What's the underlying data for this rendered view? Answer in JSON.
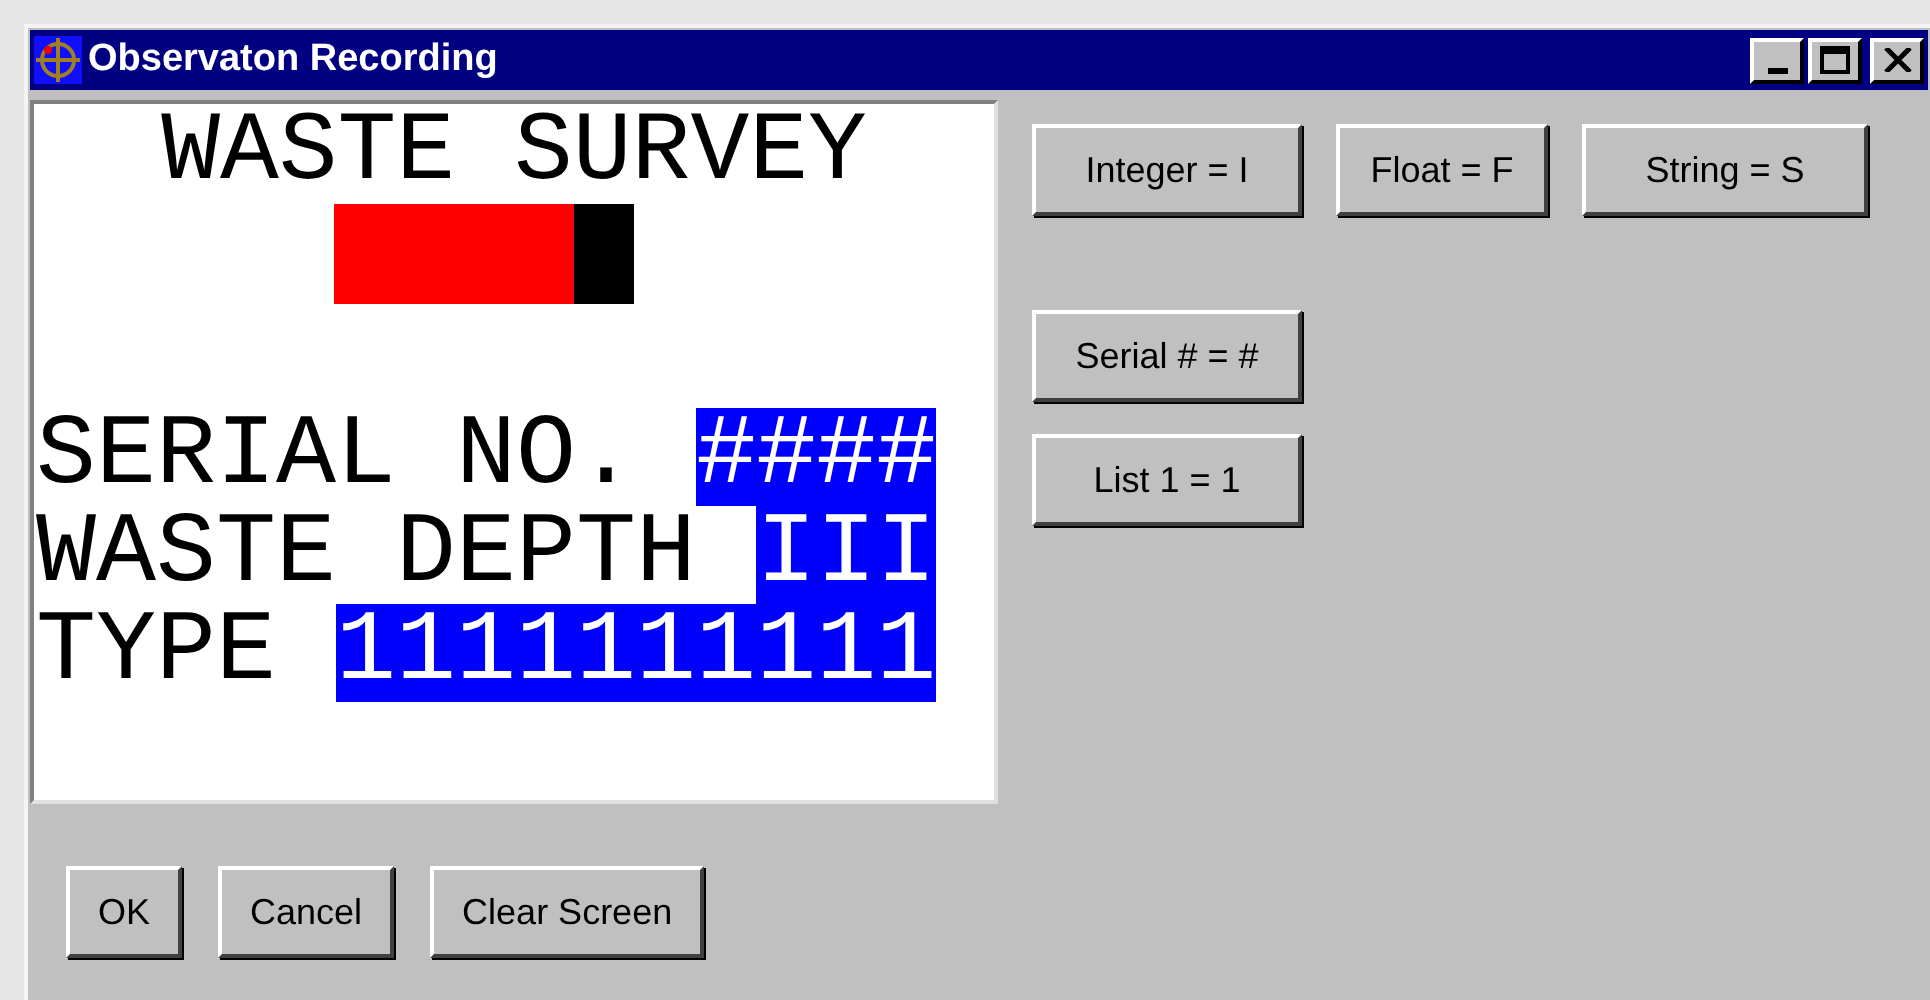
{
  "window": {
    "title": "Observaton Recording"
  },
  "preview": {
    "heading": "WASTE SURVEY",
    "meter": {
      "level": 0.8
    },
    "fields": [
      {
        "label": "SERIAL NO.",
        "value": "####"
      },
      {
        "label": "WASTE DEPTH",
        "value": "III"
      },
      {
        "label": "TYPE",
        "value": "1111111111"
      }
    ]
  },
  "format_buttons": [
    [
      "Integer = I",
      "Float = F",
      "String = S"
    ],
    [
      "Serial # = #"
    ],
    [
      "List 1 = 1"
    ]
  ],
  "buttons": [
    "OK",
    "Cancel",
    "Clear Screen"
  ]
}
